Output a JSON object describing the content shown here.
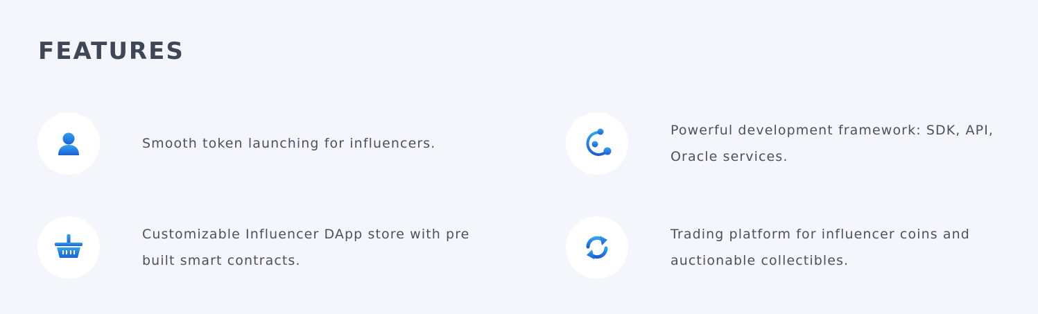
{
  "section": {
    "title": "FEATURES"
  },
  "features": [
    {
      "icon": "user-icon",
      "text": "Smooth token launching for influencers."
    },
    {
      "icon": "orbit-icon",
      "text": "Powerful development framework: SDK, API, Oracle services."
    },
    {
      "icon": "basket-icon",
      "text": "Customizable Influencer DApp store with pre built smart contracts."
    },
    {
      "icon": "refresh-icon",
      "text": "Trading platform for influencer coins and auctionable collectibles."
    }
  ],
  "colors": {
    "background": "#f4f6fb",
    "heading": "#3f4756",
    "text": "#4a5160",
    "icon_gradient_start": "#2fa3ee",
    "icon_gradient_end": "#1d5fd6",
    "icon_circle": "#ffffff"
  }
}
